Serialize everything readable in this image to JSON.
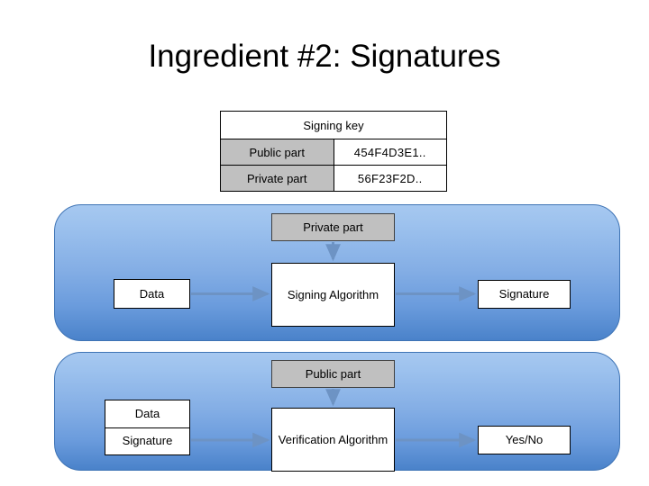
{
  "slide": {
    "title": "Ingredient #2: Signatures"
  },
  "key_table": {
    "header": "Signing key",
    "rows": [
      {
        "label": "Public part",
        "value": "454F4D3E1.."
      },
      {
        "label": "Private part",
        "value": "56F23F2D.."
      }
    ]
  },
  "signing_panel": {
    "key_input": "Private part",
    "data_box": "Data",
    "algorithm_box": "Signing Algorithm",
    "output_box": "Signature"
  },
  "verification_panel": {
    "key_input": "Public part",
    "data_box": "Data",
    "signature_box": "Signature",
    "algorithm_box": "Verification Algorithm",
    "output_box": "Yes/No"
  },
  "colors": {
    "panel_top": "#a6c8f0",
    "panel_bottom": "#4a82ca",
    "panel_border": "#3f74b5",
    "key_cell_gray": "#c0c0c0",
    "arrow": "#6d93c4",
    "box_border": "#000000",
    "text": "#000000"
  }
}
